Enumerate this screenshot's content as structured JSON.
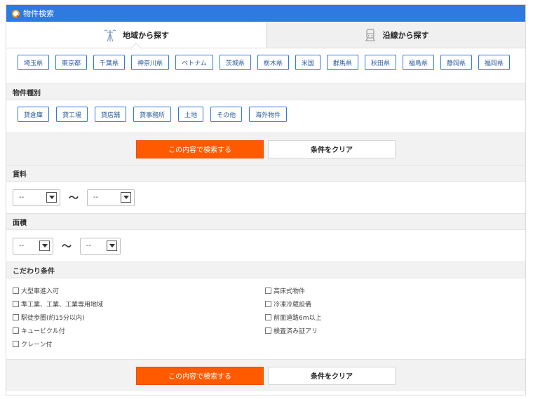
{
  "header": {
    "title": "物件検索"
  },
  "tabs": [
    {
      "label": "地域から探す"
    },
    {
      "label": "沿線から探す"
    }
  ],
  "regions": [
    "埼玉県",
    "東京都",
    "千葉県",
    "神奈川県",
    "ベトナム",
    "茨城県",
    "栃木県",
    "米国",
    "群馬県",
    "秋田県",
    "福島県",
    "静岡県",
    "福岡県"
  ],
  "type_section": {
    "title": "物件種別",
    "items": [
      "貸倉庫",
      "貸工場",
      "貸店舗",
      "貸事務所",
      "土地",
      "その他",
      "海外物件"
    ]
  },
  "buttons": {
    "search": "この内容で検索する",
    "clear": "条件をクリア"
  },
  "rent": {
    "title": "賃料",
    "min": "--",
    "max": "--",
    "sep": "〜"
  },
  "area": {
    "title": "面積",
    "min": "--",
    "max": "--",
    "sep": "〜"
  },
  "conditions": {
    "title": "こだわり条件",
    "left": [
      "大型車進入可",
      "準工業、工業、工業専用地域",
      "駅徒歩圏(約15分以内)",
      "キュービクル付",
      "クレーン付"
    ],
    "right": [
      "高床式物件",
      "冷凍冷蔵設備",
      "前面道路6m以上",
      "検査済み証アリ"
    ]
  }
}
